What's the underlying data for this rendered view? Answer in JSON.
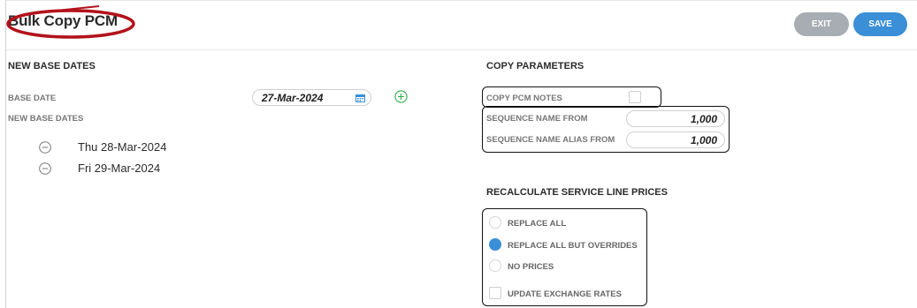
{
  "header": {
    "title": "Bulk Copy PCM",
    "exit_label": "EXIT",
    "save_label": "SAVE"
  },
  "new_base_dates": {
    "heading": "NEW BASE DATES",
    "base_date_label": "BASE DATE",
    "base_date_value": "27-Mar-2024",
    "list_label": "NEW BASE DATES",
    "dates": [
      "Thu 28-Mar-2024",
      "Fri 29-Mar-2024"
    ]
  },
  "copy_parameters": {
    "heading": "COPY PARAMETERS",
    "copy_notes_label": "COPY PCM NOTES",
    "copy_notes_checked": false,
    "seq_name_from_label": "SEQUENCE NAME FROM",
    "seq_name_from_value": "1,000",
    "seq_alias_from_label": "SEQUENCE NAME ALIAS FROM",
    "seq_alias_from_value": "1,000"
  },
  "recalculate": {
    "heading": "RECALCULATE SERVICE LINE PRICES",
    "options": [
      "REPLACE ALL",
      "REPLACE ALL BUT OVERRIDES",
      "NO PRICES"
    ],
    "selected_option": "REPLACE ALL BUT OVERRIDES",
    "update_fx_label": "UPDATE EXCHANGE RATES",
    "update_fx_checked": false
  },
  "colors": {
    "accent_blue": "#3a8fd6",
    "exit_grey": "#a8adb3",
    "add_green": "#2fae4a",
    "title_annotation_red": "#b3121b"
  }
}
